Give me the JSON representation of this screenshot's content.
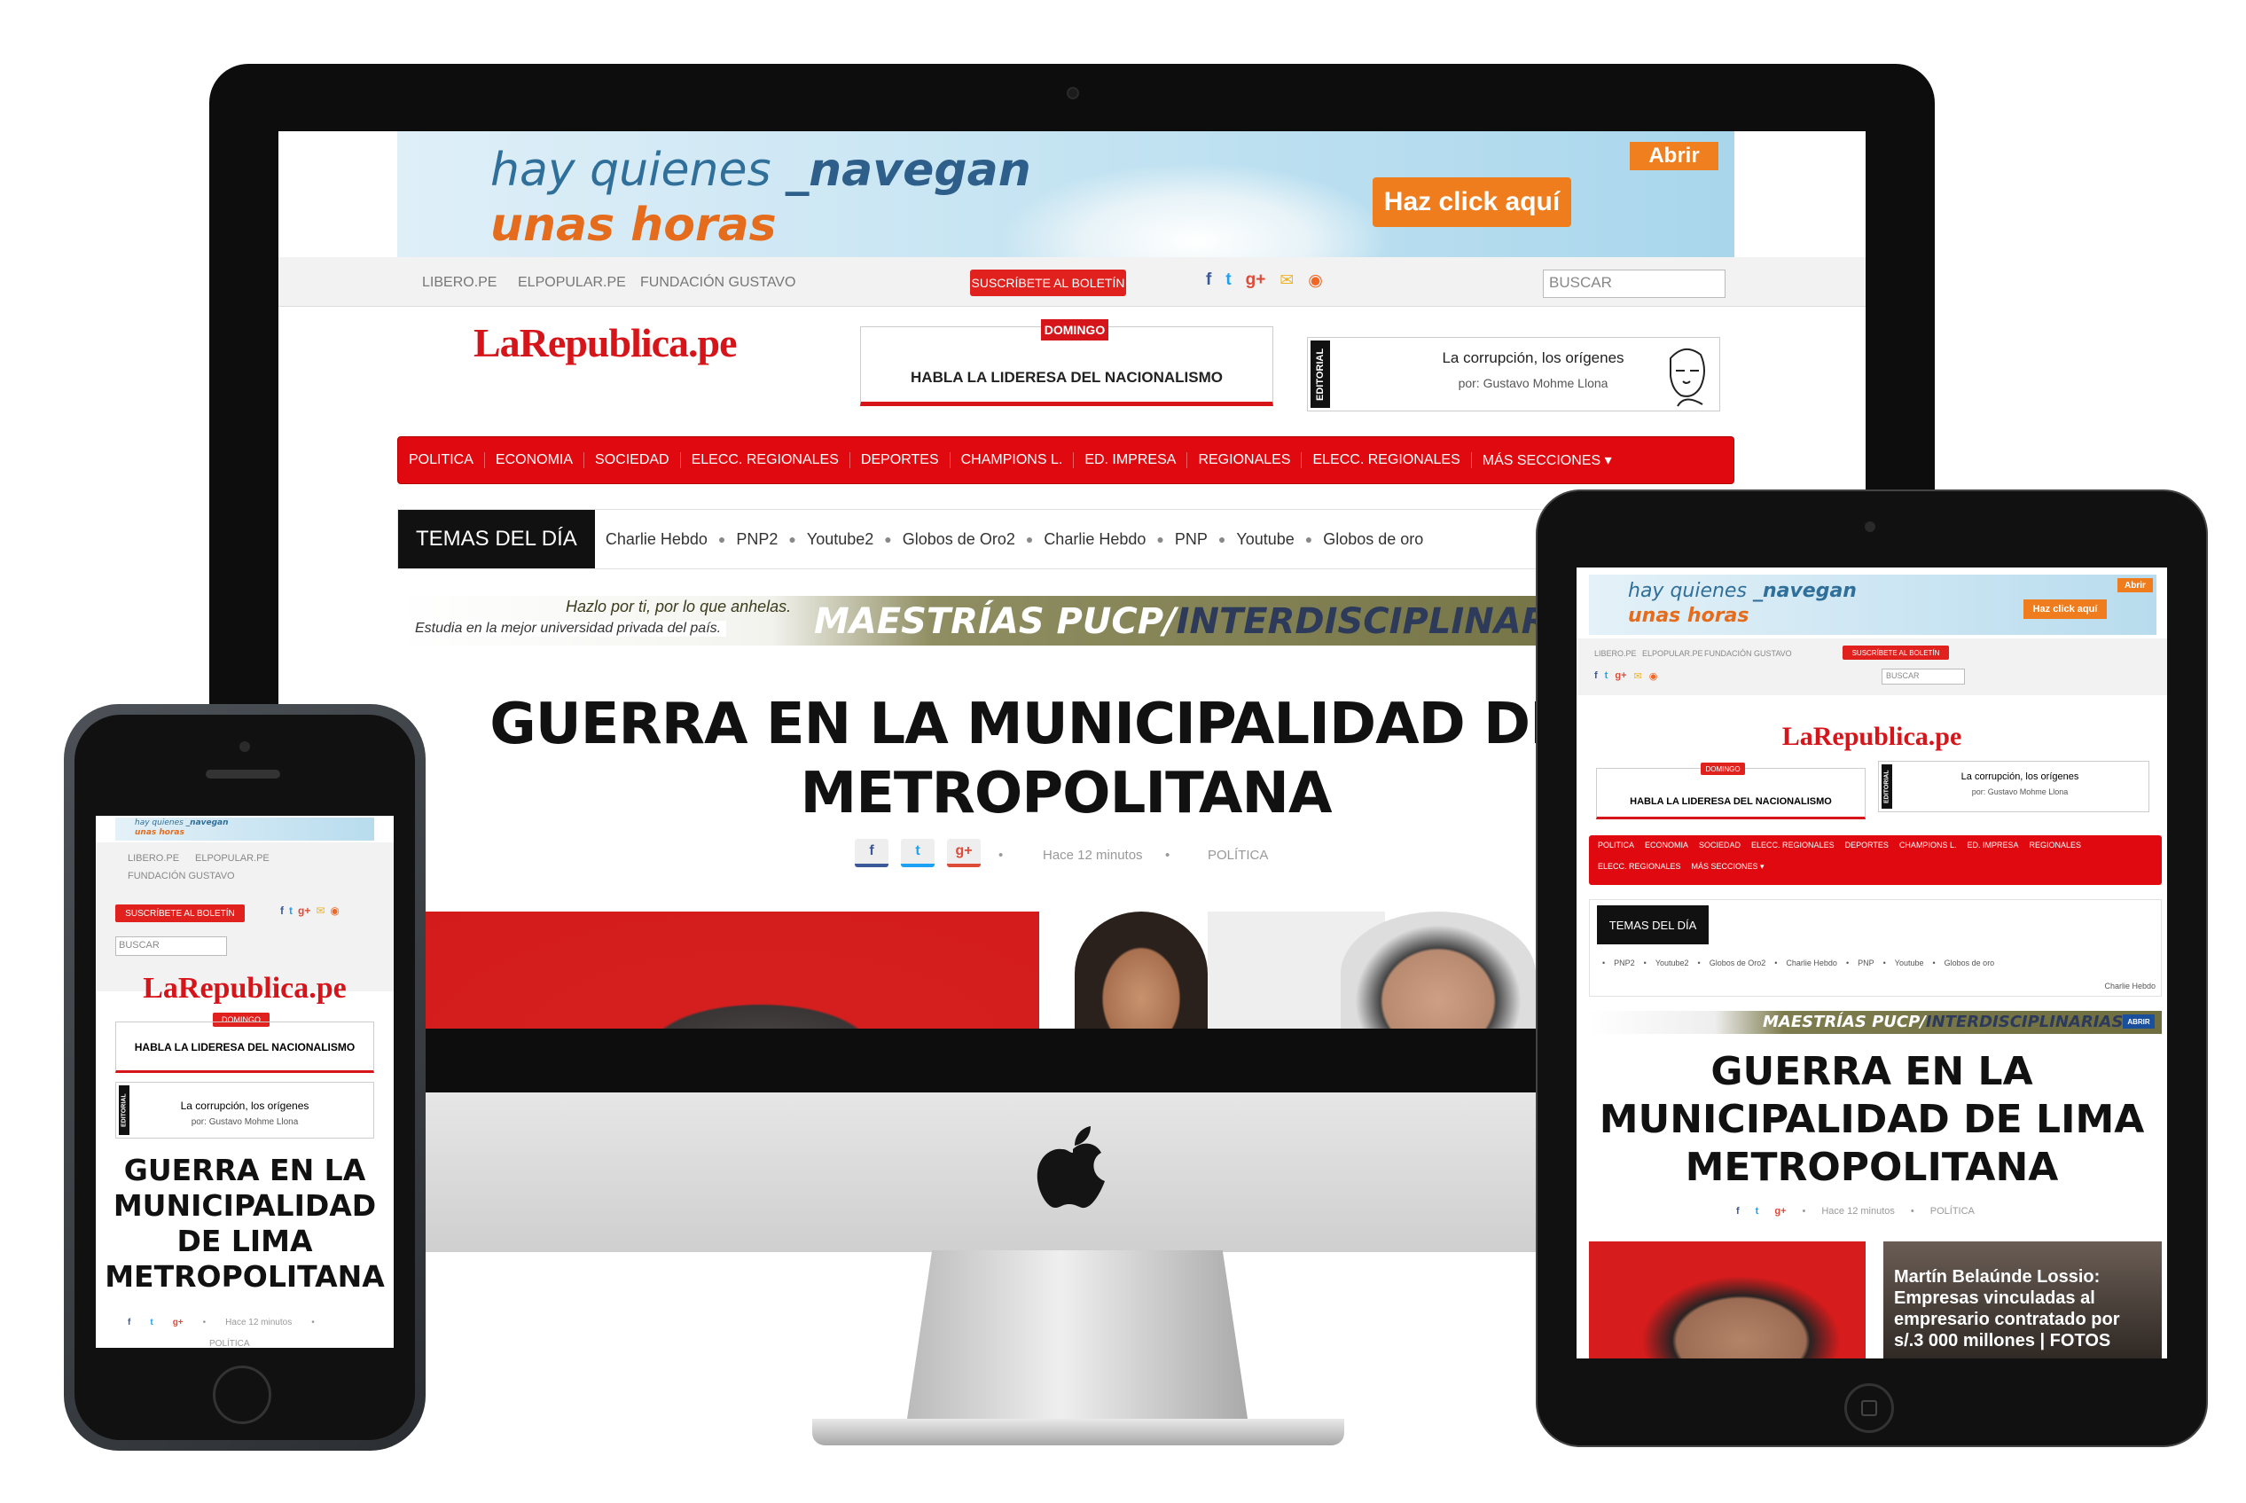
{
  "site": {
    "logo": "LaRepublica.pe",
    "ad": {
      "line1_prefix": "hay quienes ",
      "line1_emph": "_navegan",
      "line2": "unas horas",
      "abrir": "Abrir",
      "cta": "Haz click aquí"
    },
    "top_links": [
      "LIBERO.PE",
      "ELPOPULAR.PE",
      "FUNDACIÓN GUSTAVO"
    ],
    "subscribe": "SUSCRÍBETE AL BOLETÍN",
    "social_icons": [
      "facebook-icon",
      "twitter-icon",
      "google-plus-icon",
      "mail-icon",
      "rss-icon"
    ],
    "social_glyphs": [
      "f",
      "t",
      "g+",
      "✉",
      "◉"
    ],
    "social_colors": [
      "#3b5998",
      "#1da1f2",
      "#dd4b39",
      "#f0b323",
      "#f26522"
    ],
    "search_placeholder": "BUSCAR",
    "featured": {
      "badge": "DOMINGO",
      "title": "HABLA LA LIDERESA DEL NACIONALISMO"
    },
    "editorial": {
      "tag": "EDITORIAL",
      "title": "La corrupción, los orígenes",
      "author": "por: Gustavo Mohme Llona"
    },
    "nav": [
      "POLITICA",
      "ECONOMIA",
      "SOCIEDAD",
      "ELECC. REGIONALES",
      "DEPORTES",
      "CHAMPIONS L.",
      "ED. IMPRESA",
      "REGIONALES",
      "ELECC. REGIONALES",
      "MÁS SECCIONES ▾"
    ],
    "temas_label": "TEMAS DEL DÍA",
    "temas": [
      "Charlie Hebdo",
      "PNP2",
      "Youtube2",
      "Globos de Oro2",
      "Charlie Hebdo",
      "PNP",
      "Youtube",
      "Globos de oro"
    ],
    "banner": {
      "line_a": "Hazlo por ti, por lo que anhelas.",
      "line_b": "Estudia en la mejor universidad privada del país.",
      "title_a": "MAESTRÍAS PUCP/",
      "title_b": "INTERDISCIPLINARIAS",
      "ipad_btn": "ABRIR"
    },
    "headline_desktop": "GUERRA EN LA MUNICIPALIDAD DE LIMA METROPOLITANA",
    "headline_lines_desktop": [
      "GUERRA EN LA MUNICIPALIDAD DE LI",
      "METROPOLITANA"
    ],
    "headline_lines_ipad": [
      "GUERRA EN LA",
      "MUNICIPALIDAD DE LIMA",
      "METROPOLITANA"
    ],
    "headline_lines_phone": [
      "GUERRA EN LA",
      "MUNICIPALIDAD",
      "DE LIMA",
      "METROPOLITANA"
    ],
    "meta_time": "Hace 12 minutos",
    "meta_section": "POLÍTICA",
    "ipad_temas": [
      "PNP2",
      "Youtube2",
      "Globos de Oro2",
      "Charlie Hebdo",
      "PNP",
      "Youtube",
      "Globos de oro"
    ],
    "ipad_temas_wrap": "Charlie Hebdo",
    "ipad_nav_row1": [
      "POLITICA",
      "ECONOMIA",
      "SOCIEDAD",
      "ELECC. REGIONALES",
      "DEPORTES",
      "CHAMPIONS L.",
      "ED. IMPRESA",
      "REGIONALES"
    ],
    "ipad_nav_row2": [
      "ELECC. REGIONALES",
      "MÁS SECCIONES ▾"
    ],
    "ipad_story": "Martín Belaúnde Lossio: Empresas vinculadas al empresario contratado por s/.3 000 millones | FOTOS"
  }
}
